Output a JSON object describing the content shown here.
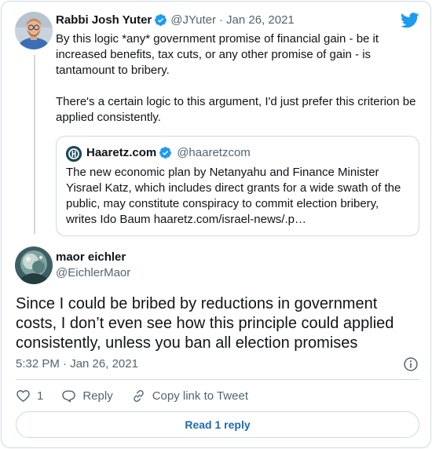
{
  "colors": {
    "twitter_blue": "#1d9bf0",
    "text_primary": "#0f1419",
    "text_secondary": "#536471",
    "border": "#cfd9de",
    "link": "#1d6bb0"
  },
  "icons": {
    "brand": "twitter-bird-icon",
    "verified": "verified-badge-icon",
    "info": "info-icon",
    "like": "heart-icon",
    "reply": "speech-bubble-icon",
    "copy": "link-icon"
  },
  "parent_tweet": {
    "name": "Rabbi Josh Yuter",
    "handle": "@JYuter",
    "separator": "·",
    "date": "Jan 26, 2021",
    "paragraphs": [
      "By this logic *any* government promise of financial gain - be it increased benefits, tax cuts, or any other promise of gain - is tantamount to bribery.",
      "There's a certain logic to this argument, I'd just prefer this criterion be applied consistently."
    ]
  },
  "quoted_tweet": {
    "name": "Haaretz.com",
    "handle": "@haaretzcom",
    "text": "The new economic plan by Netanyahu and Finance Minister Yisrael Katz, which includes direct grants for a wide swath of the public, may constitute conspiracy to commit election bribery, writes Ido Baum haaretz.com/israel-news/.p…"
  },
  "main_tweet": {
    "name": "maor eichler",
    "handle": "@EichlerMaor",
    "text": "Since I could be bribed by reductions in government costs, I don’t even see how this principle could applied consistently, unless you ban all election promises",
    "timestamp": "5:32 PM · Jan 26, 2021"
  },
  "actions": {
    "like_count": "1",
    "reply_label": "Reply",
    "copy_label": "Copy link to Tweet"
  },
  "read_reply_label": "Read 1 reply"
}
